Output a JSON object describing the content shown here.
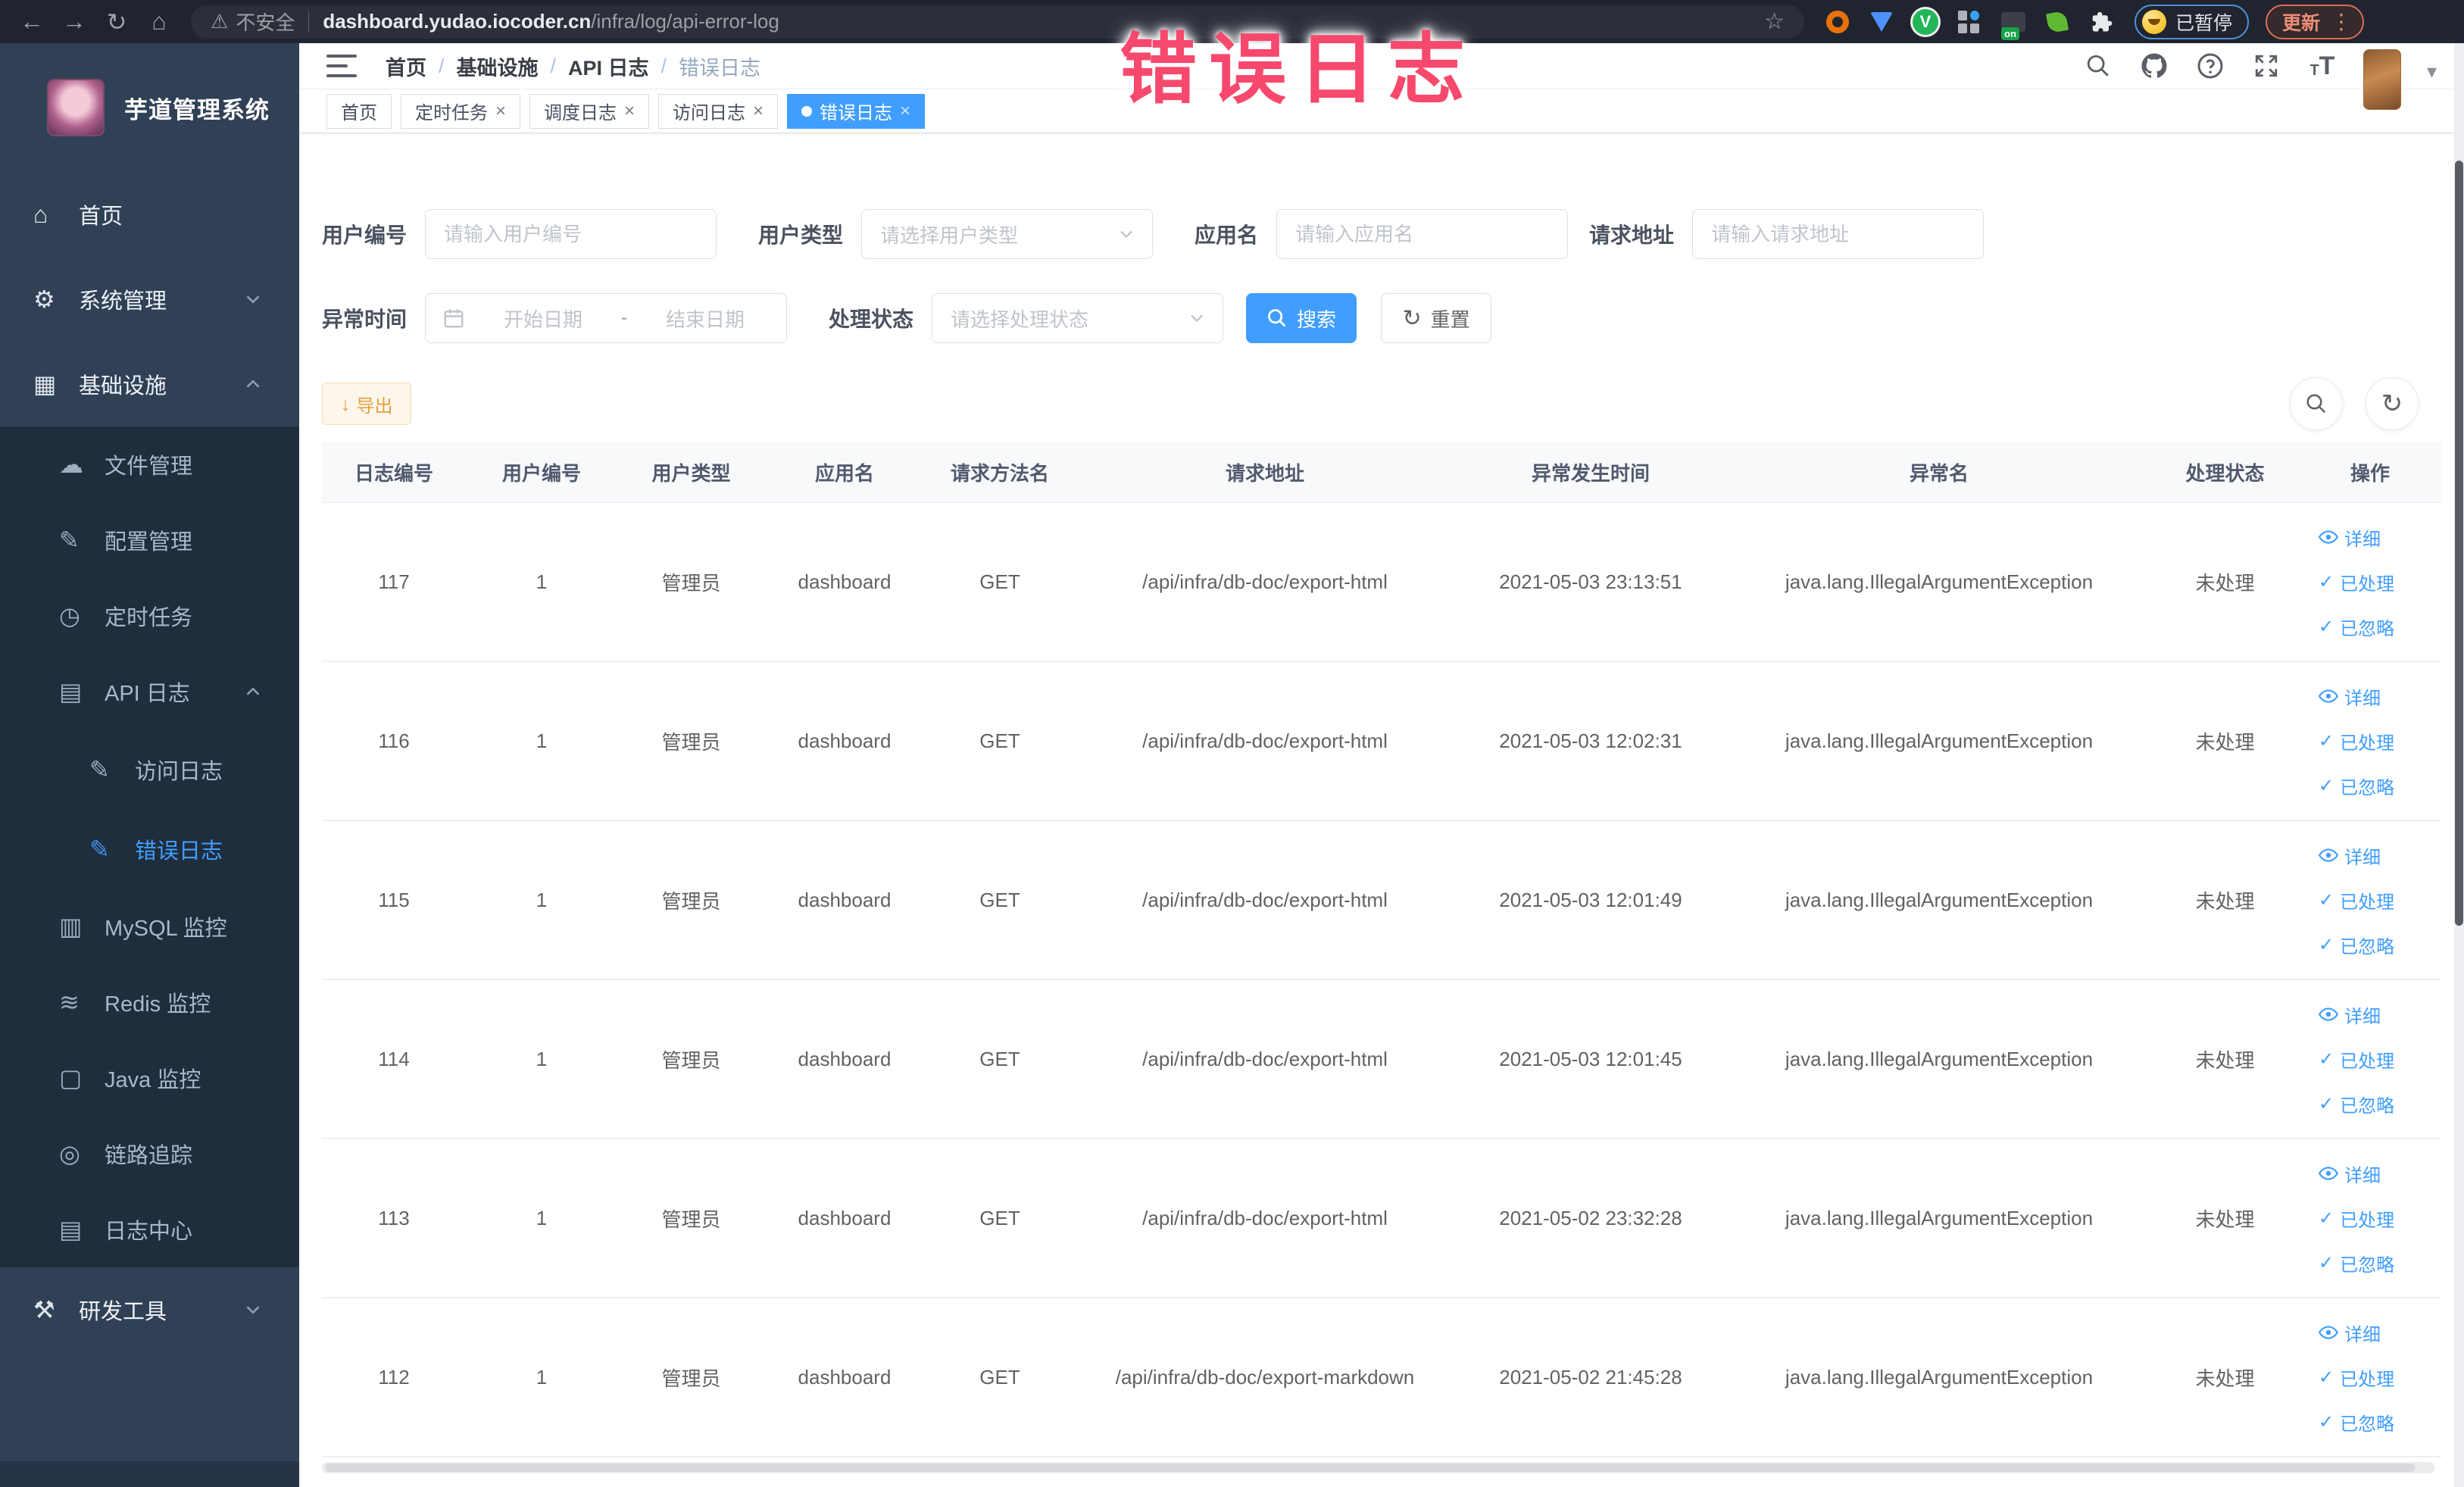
{
  "colors": {
    "accent": "#409eff",
    "warning": "#e6a23c",
    "sidebar_bg": "#304156",
    "submenu_bg": "#1f2d3d",
    "annotation_pink": "#f7496d",
    "active_tab_bg": "#409eff"
  },
  "annotation": {
    "text": "错误日志"
  },
  "browser": {
    "security_label": "不安全",
    "url_host": "dashboard.yudao.iocoder.cn",
    "url_path": "/infra/log/api-error-log",
    "profile_status": "已暂停",
    "update_label": "更新"
  },
  "sidebar": {
    "app_title": "芋道管理系统",
    "items": [
      {
        "name": "home",
        "label": "首页",
        "glyph": "⌂",
        "icon": "home-icon",
        "level": 1
      },
      {
        "name": "system",
        "label": "系统管理",
        "glyph": "⚙",
        "icon": "gear-icon",
        "level": 1,
        "chevron": "down"
      },
      {
        "name": "infra",
        "label": "基础设施",
        "glyph": "▦",
        "icon": "monitor-icon",
        "level": 1,
        "chevron": "up"
      },
      {
        "name": "file",
        "label": "文件管理",
        "glyph": "☁",
        "icon": "cloud-upload-icon",
        "level": 2
      },
      {
        "name": "config",
        "label": "配置管理",
        "glyph": "✎",
        "icon": "edit-icon",
        "level": 2
      },
      {
        "name": "job",
        "label": "定时任务",
        "glyph": "◷",
        "icon": "timer-icon",
        "level": 2
      },
      {
        "name": "api-log",
        "label": "API 日志",
        "glyph": "▤",
        "icon": "api-log-icon",
        "level": 2,
        "chevron": "up"
      },
      {
        "name": "access-log",
        "label": "访问日志",
        "glyph": "✎",
        "icon": "access-log-icon",
        "level": 3
      },
      {
        "name": "error-log",
        "label": "错误日志",
        "glyph": "✎",
        "icon": "error-log-icon",
        "level": 3,
        "active": true
      },
      {
        "name": "mysql",
        "label": "MySQL 监控",
        "glyph": "▥",
        "icon": "mysql-icon",
        "level": 2
      },
      {
        "name": "redis",
        "label": "Redis 监控",
        "glyph": "≋",
        "icon": "redis-icon",
        "level": 2
      },
      {
        "name": "java",
        "label": "Java 监控",
        "glyph": "▢",
        "icon": "java-monitor-icon",
        "level": 2
      },
      {
        "name": "trace",
        "label": "链路追踪",
        "glyph": "◎",
        "icon": "trace-icon",
        "level": 2
      },
      {
        "name": "log-center",
        "label": "日志中心",
        "glyph": "▤",
        "icon": "log-center-icon",
        "level": 2
      },
      {
        "name": "devtools",
        "label": "研发工具",
        "glyph": "⚒",
        "icon": "devtools-icon",
        "level": 1,
        "chevron": "down"
      }
    ]
  },
  "header": {
    "breadcrumb": [
      "首页",
      "基础设施",
      "API 日志",
      "错误日志"
    ]
  },
  "tabs": [
    {
      "label": "首页",
      "closable": false,
      "active": false
    },
    {
      "label": "定时任务",
      "closable": true,
      "active": false
    },
    {
      "label": "调度日志",
      "closable": true,
      "active": false
    },
    {
      "label": "访问日志",
      "closable": true,
      "active": false
    },
    {
      "label": "错误日志",
      "closable": true,
      "active": true
    }
  ],
  "filters": {
    "user_id": {
      "label": "用户编号",
      "placeholder": "请输入用户编号"
    },
    "user_type": {
      "label": "用户类型",
      "placeholder": "请选择用户类型"
    },
    "app_name": {
      "label": "应用名",
      "placeholder": "请输入应用名"
    },
    "request_url": {
      "label": "请求地址",
      "placeholder": "请输入请求地址"
    },
    "exception_time": {
      "label": "异常时间",
      "start_placeholder": "开始日期",
      "separator": "-",
      "end_placeholder": "结束日期"
    },
    "process_status": {
      "label": "处理状态",
      "placeholder": "请选择处理状态"
    },
    "search_label": "搜索",
    "reset_label": "重置"
  },
  "toolbar": {
    "export_label": "导出"
  },
  "table": {
    "columns": [
      "日志编号",
      "用户编号",
      "用户类型",
      "应用名",
      "请求方法名",
      "请求地址",
      "异常发生时间",
      "异常名",
      "处理状态",
      "操作"
    ],
    "action_labels": [
      "详细",
      "已处理",
      "已忽略"
    ],
    "rows": [
      {
        "id": "117",
        "user_id": "1",
        "user_type": "管理员",
        "app": "dashboard",
        "method": "GET",
        "url": "/api/infra/db-doc/export-html",
        "time": "2021-05-03 23:13:51",
        "exception": "java.lang.IllegalArgumentException",
        "status": "未处理"
      },
      {
        "id": "116",
        "user_id": "1",
        "user_type": "管理员",
        "app": "dashboard",
        "method": "GET",
        "url": "/api/infra/db-doc/export-html",
        "time": "2021-05-03 12:02:31",
        "exception": "java.lang.IllegalArgumentException",
        "status": "未处理"
      },
      {
        "id": "115",
        "user_id": "1",
        "user_type": "管理员",
        "app": "dashboard",
        "method": "GET",
        "url": "/api/infra/db-doc/export-html",
        "time": "2021-05-03 12:01:49",
        "exception": "java.lang.IllegalArgumentException",
        "status": "未处理"
      },
      {
        "id": "114",
        "user_id": "1",
        "user_type": "管理员",
        "app": "dashboard",
        "method": "GET",
        "url": "/api/infra/db-doc/export-html",
        "time": "2021-05-03 12:01:45",
        "exception": "java.lang.IllegalArgumentException",
        "status": "未处理"
      },
      {
        "id": "113",
        "user_id": "1",
        "user_type": "管理员",
        "app": "dashboard",
        "method": "GET",
        "url": "/api/infra/db-doc/export-html",
        "time": "2021-05-02 23:32:28",
        "exception": "java.lang.IllegalArgumentException",
        "status": "未处理"
      },
      {
        "id": "112",
        "user_id": "1",
        "user_type": "管理员",
        "app": "dashboard",
        "method": "GET",
        "url": "/api/infra/db-doc/export-markdown",
        "time": "2021-05-02 21:45:28",
        "exception": "java.lang.IllegalArgumentException",
        "status": "未处理"
      }
    ]
  }
}
